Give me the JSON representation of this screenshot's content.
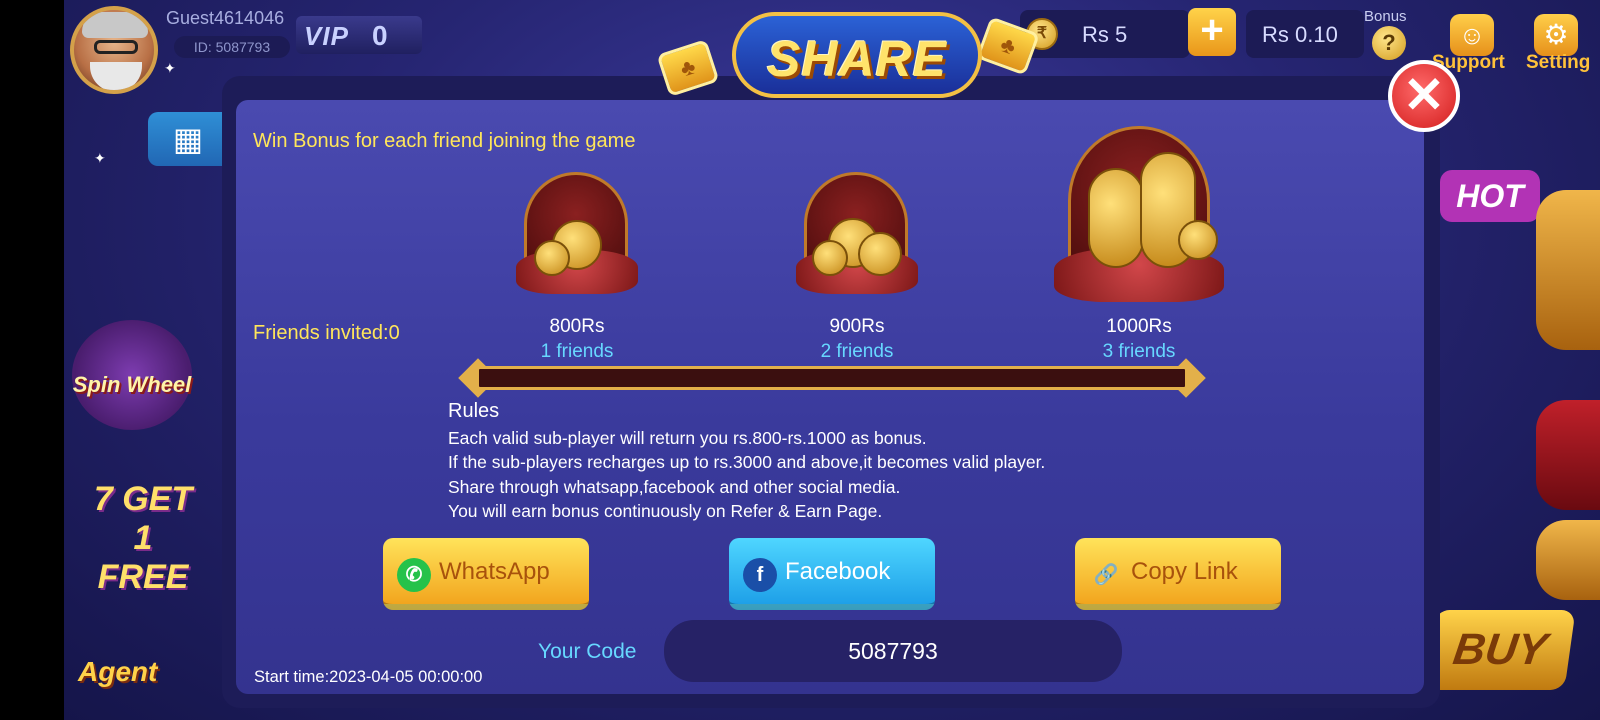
{
  "header": {
    "username": "Guest4614046",
    "user_id": "ID: 5087793",
    "vip_label": "VIP",
    "vip_level": "0",
    "balance": "Rs  5",
    "bonus_balance": "Rs  0.10",
    "bonus_label": "Bonus",
    "support_label": "Support",
    "setting_label": "Setting"
  },
  "side_games": {
    "spin_wheel": "Spin Wheel",
    "seven_get": "7 GET 1 FREE",
    "agent": "Agent",
    "hot": "HOT",
    "buy": "BUY"
  },
  "dialog": {
    "title": "SHARE",
    "subtitle": "Win Bonus for each friend joining the game",
    "friends_invited": "Friends invited:0",
    "progress_fraction": 0,
    "rewards": [
      {
        "amount": "800Rs",
        "friends": "1 friends"
      },
      {
        "amount": "900Rs",
        "friends": "2 friends"
      },
      {
        "amount": "1000Rs",
        "friends": "3 friends"
      }
    ],
    "rules_title": "Rules",
    "rules": [
      "Each valid sub-player will return you rs.800-rs.1000 as bonus.",
      "If the sub-players recharges up to rs.3000 and above,it becomes valid player.",
      "Share through whatsapp,facebook and other social media.",
      "You will earn bonus continuously on Refer & Earn Page."
    ],
    "buttons": {
      "whatsapp": "WhatsApp",
      "facebook": "Facebook",
      "copy_link": "Copy Link"
    },
    "code_label": "Your Code",
    "code_value": "5087793",
    "start_time": "Start time:2023-04-05 00:00:00"
  },
  "colors": {
    "accent_yellow": "#ffe65a",
    "accent_blue": "#67d8ff",
    "dialog_bg": "#3a3a9c",
    "close_red": "#d21c1c"
  }
}
